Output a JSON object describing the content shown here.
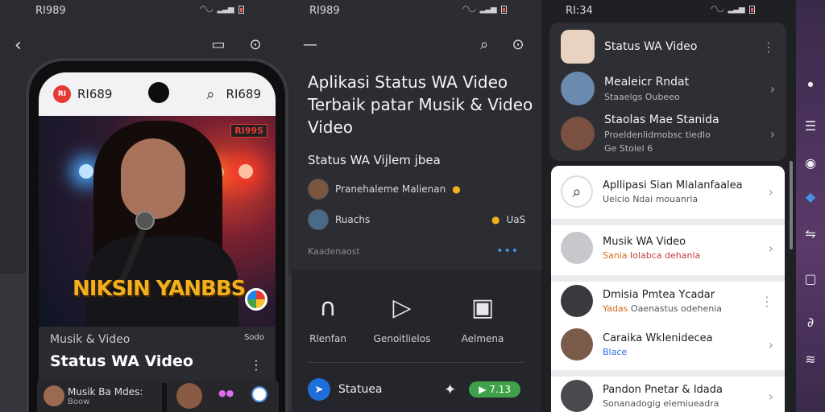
{
  "panel1": {
    "status_time": "RI989",
    "phone": {
      "brand_logo": "RI",
      "brand_name": "RI689",
      "right_label": "RI689",
      "hero_tag": "RI99S",
      "hero_title": "NIKSIN YANBBS",
      "category": "Musik & Video",
      "count": "Sodo",
      "title": "Status WA Video",
      "thumbs": [
        {
          "label": "Musik Ba Mdes:",
          "sub": "Boow"
        },
        {
          "label": "",
          "sub": ""
        }
      ]
    }
  },
  "panel2": {
    "status_time": "RI989",
    "headline": "Aplikasi Status WA Video Terbaik patar Musik & Video Video",
    "subhead": "Status WA Vijlem jbea",
    "row1": "Pranehaleme Malienan",
    "row2": "Ruachs",
    "row2_right": "UaS",
    "small": "Kaadenaost",
    "actions": [
      {
        "label": "Rlenfan",
        "icon": "headphones-icon"
      },
      {
        "label": "Genoitlielos",
        "icon": "play-icon"
      },
      {
        "label": "Aelmena",
        "icon": "image-icon"
      }
    ],
    "bottom_label": "Statuea",
    "bottom_pill": "7.13"
  },
  "panel3": {
    "status_time": "RI:34",
    "top_items": [
      {
        "t1": "Status WA Video",
        "t2": ""
      },
      {
        "t1": "Mealeicr Rndat",
        "t2": "Staaelgs Oubeeo"
      },
      {
        "t1": "Staolas Mae Stanida",
        "t2": "Proeldenlidmobsc tiedlo"
      }
    ],
    "top_items_extra": "Ge Stolel 6",
    "white_items": [
      {
        "t1": "Apllipasi Sian Mlalanfaalea",
        "t2": "Uelcio Ndai mouanrla"
      },
      {
        "t1": "Musik WA Video",
        "t2": "Sania",
        "t2b": "Iolabca dehanla"
      },
      {
        "t1": "Dmisia Pmtea Ycadar",
        "t2": "Yadas",
        "t2b": "Oaenastus odehenia"
      },
      {
        "t1": "Caraika Wklenidecea",
        "t2": "Blace"
      },
      {
        "t1": "Pandon Pnetar & Idada",
        "t2": "Sonanadogig elemiueadra"
      }
    ]
  },
  "colors": {
    "accent_blue": "#1e6fd9",
    "accent_green": "#3fa14a",
    "hero_yellow": "#f2b01e",
    "brand_red": "#e53935"
  }
}
